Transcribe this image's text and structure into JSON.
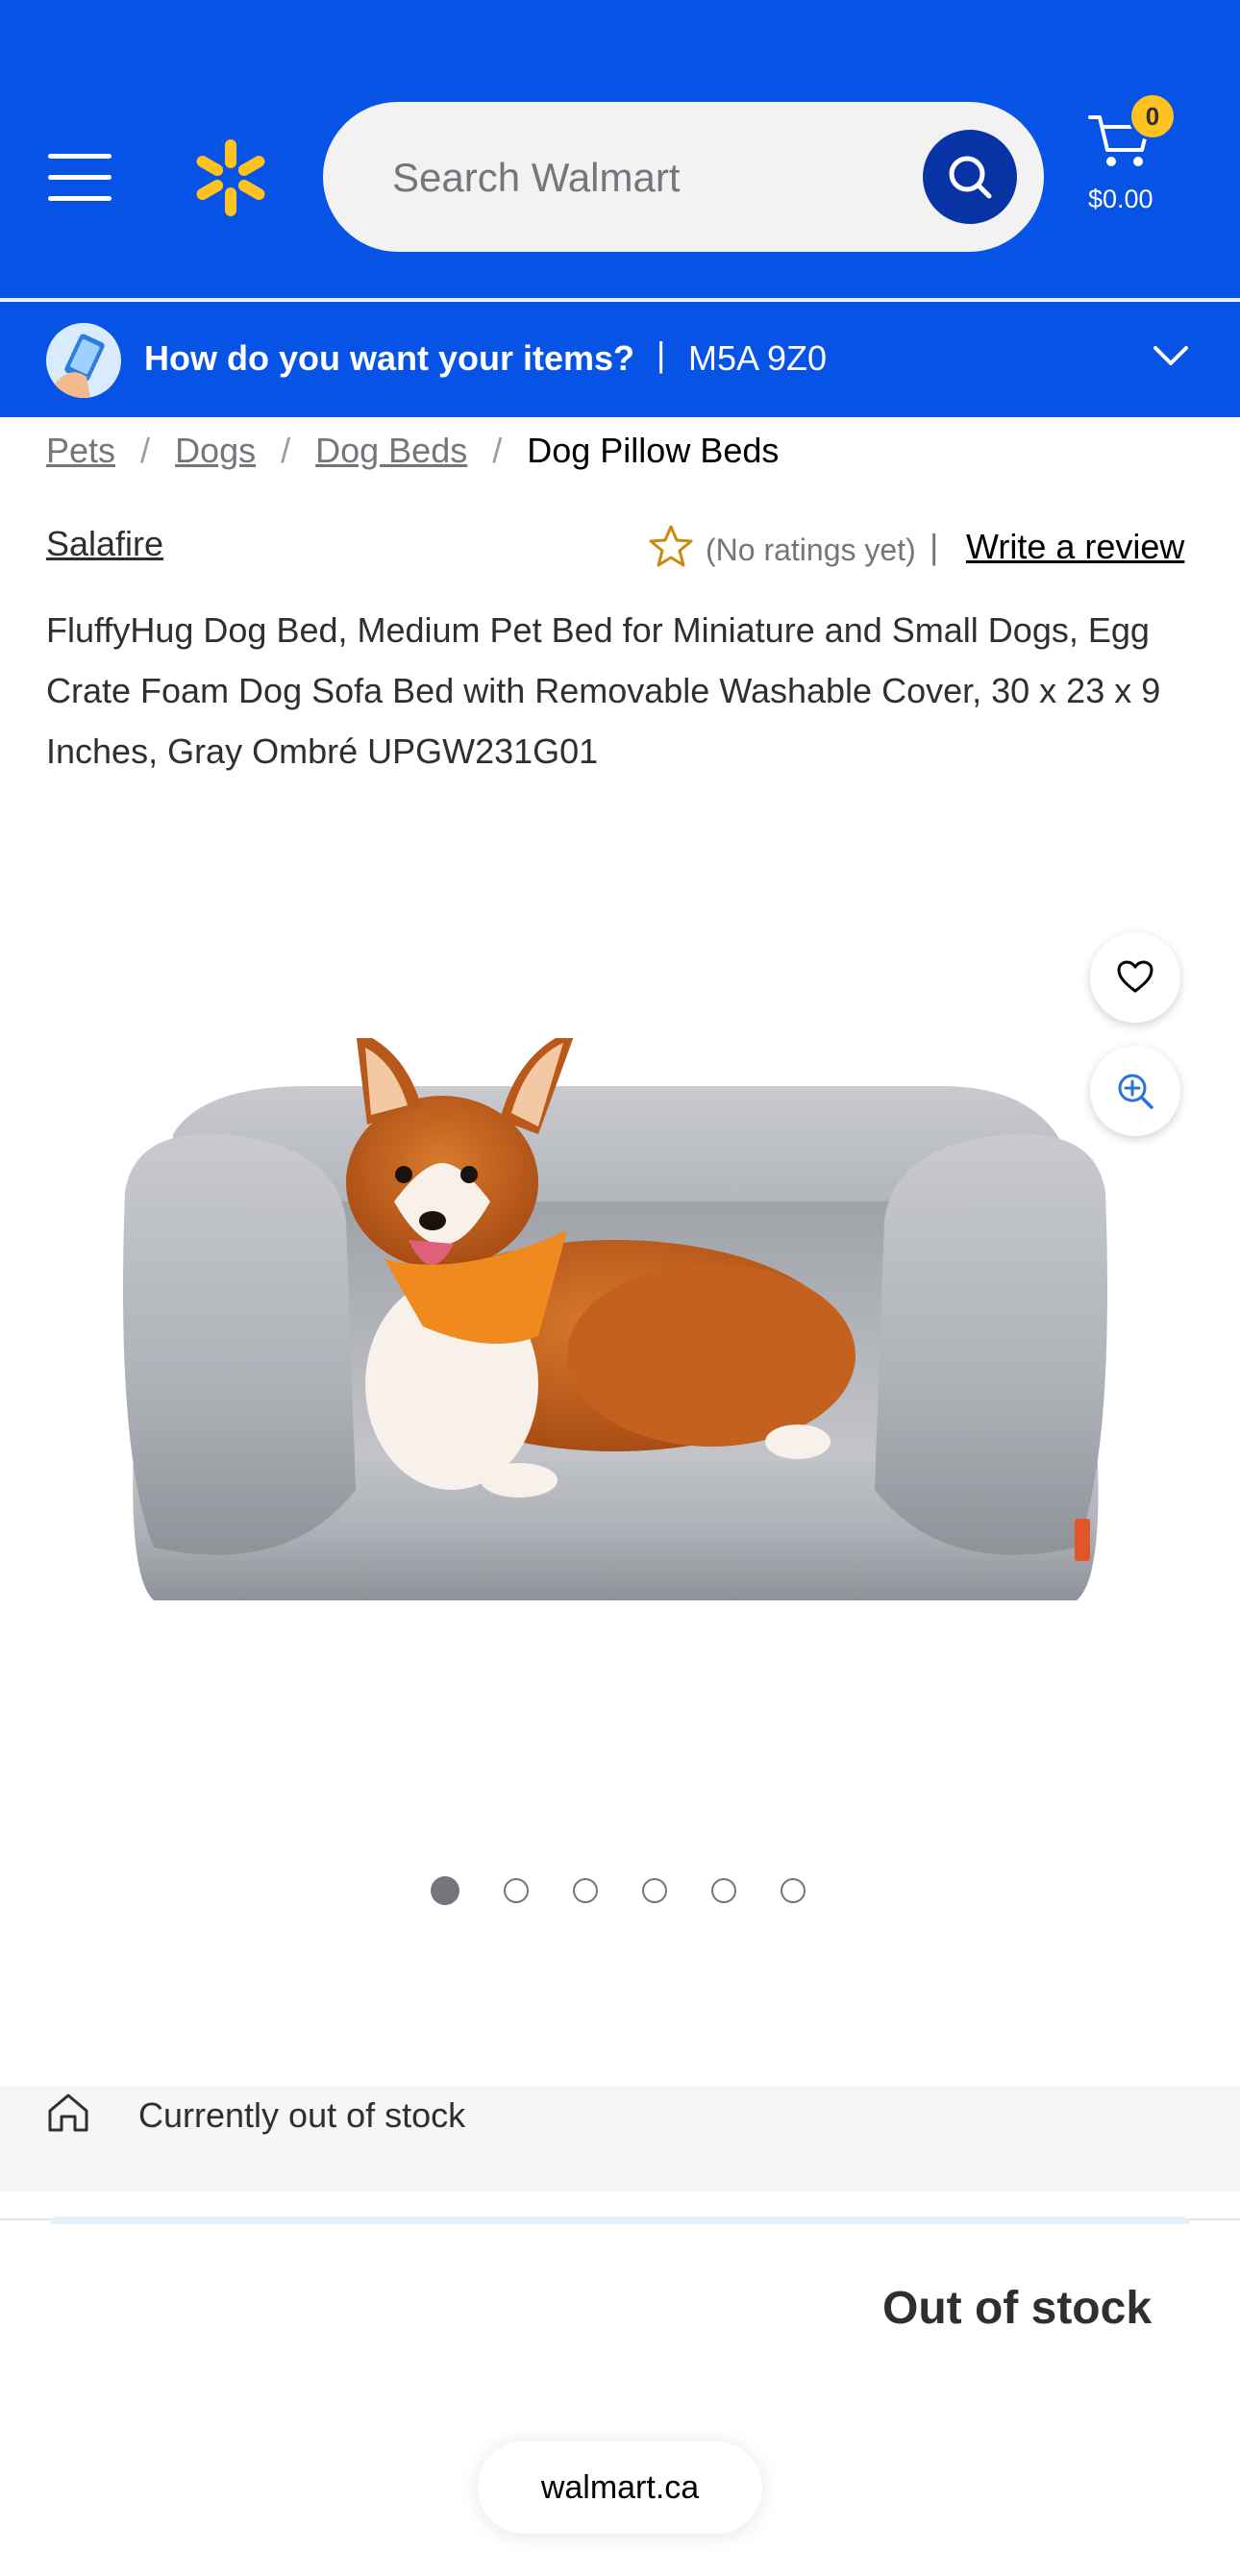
{
  "header": {
    "search_placeholder": "Search Walmart",
    "cart_count": "0",
    "cart_total": "$0.00"
  },
  "delivery": {
    "question": "How do you want your items?",
    "separator": "|",
    "postal_code": "M5A 9Z0"
  },
  "breadcrumb": {
    "items": [
      "Pets",
      "Dogs",
      "Dog Beds"
    ],
    "separator": "/",
    "current": "Dog Pillow Beds"
  },
  "product": {
    "seller": "Salafire",
    "rating_text": "(No ratings yet)",
    "rating_separator": "|",
    "write_review": "Write a review",
    "title": "FluffyHug Dog Bed, Medium Pet Bed for Miniature and Small Dogs, Egg Crate Foam Dog Sofa Bed with Removable Washable Cover, 30 x 23 x 9 Inches, Gray Ombré UPGW231G01",
    "image_count": 6,
    "active_image_index": 0
  },
  "stock": {
    "message": "Currently out of stock",
    "status_title": "Out of stock"
  },
  "browser": {
    "url": "walmart.ca"
  },
  "icons": {
    "menu": "hamburger-icon",
    "logo": "walmart-spark-icon",
    "search": "search-icon",
    "cart": "cart-icon",
    "chevron": "chevron-down-icon",
    "favorite": "heart-icon",
    "zoom": "zoom-in-icon",
    "store": "store-icon",
    "star": "star-outline-icon"
  },
  "colors": {
    "brand_blue": "#0753e5",
    "dark_blue": "#0733a4",
    "spark_yellow": "#ffc220",
    "text": "#2e2f32",
    "muted": "#74767c"
  }
}
